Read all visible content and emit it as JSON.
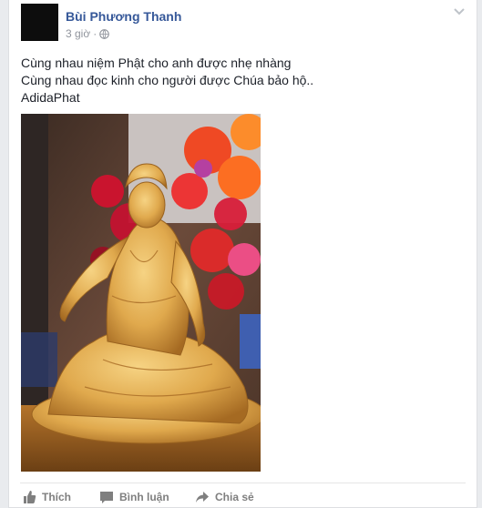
{
  "post": {
    "author": "Bùi Phương Thanh",
    "time": "3 giờ",
    "separator": "·",
    "lines": [
      "Cùng nhau niệm Phật cho anh được nhẹ nhàng",
      "Cùng nhau đọc kinh cho người được Chúa bảo hộ..",
      "AdidaPhat"
    ]
  },
  "actions": {
    "like": "Thích",
    "comment": "Bình luận",
    "share": "Chia sẻ"
  },
  "icons": {
    "privacy": "globe-icon",
    "options": "chevron-down-icon",
    "like": "thumbs-up-icon",
    "comment": "comment-icon",
    "share": "share-arrow-icon"
  },
  "colors": {
    "author": "#365899",
    "text": "#1d2129",
    "meta": "#90949c",
    "action": "#7f7f7f"
  }
}
